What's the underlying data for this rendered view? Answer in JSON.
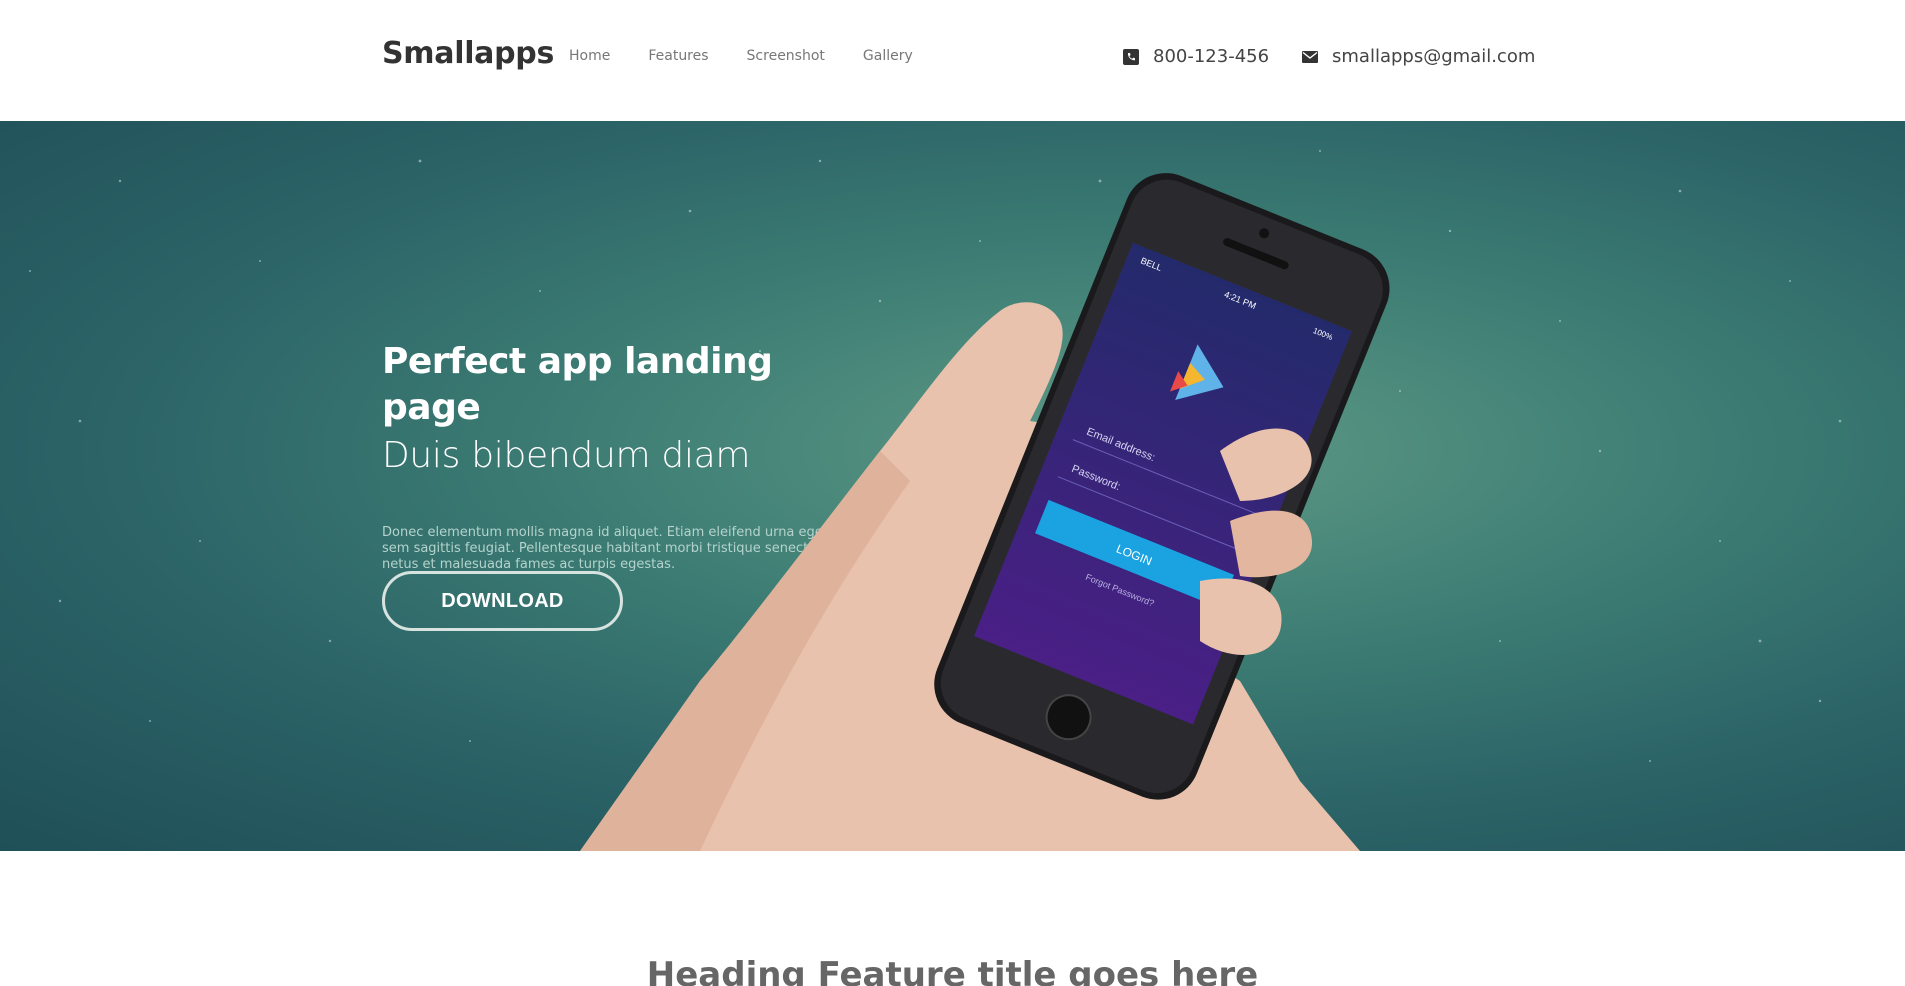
{
  "header": {
    "brand": "Smallapps",
    "nav": [
      {
        "label": "Home"
      },
      {
        "label": "Features"
      },
      {
        "label": "Screenshot"
      },
      {
        "label": "Gallery"
      }
    ],
    "phone": {
      "icon": "phone-icon",
      "text": "800-123-456"
    },
    "email": {
      "icon": "envelope-icon",
      "text": "smallapps@gmail.com"
    }
  },
  "hero": {
    "title": "Perfect app landing page",
    "subtitle": "Duis bibendum diam",
    "body": "Donec elementum mollis magna id aliquet. Etiam eleifend urna eget sem sagittis feugiat. Pellentesque habitant morbi tristique senectus et netus et malesuada fames ac turpis egestas.",
    "download_label": "DOWNLOAD",
    "phone_screen": {
      "carrier": "BELL",
      "time": "4:21 PM",
      "battery": "100%",
      "email_placeholder": "Email address:",
      "password_placeholder": "Password:",
      "login_label": "LOGIN",
      "forgot_label": "Forgot Password?"
    }
  },
  "features": {
    "heading": "Heading Feature title goes here"
  },
  "colors": {
    "hero_teal": "#3d7d74",
    "login_blue": "#1aa3e0",
    "screen_purple": "#3a2a85"
  }
}
